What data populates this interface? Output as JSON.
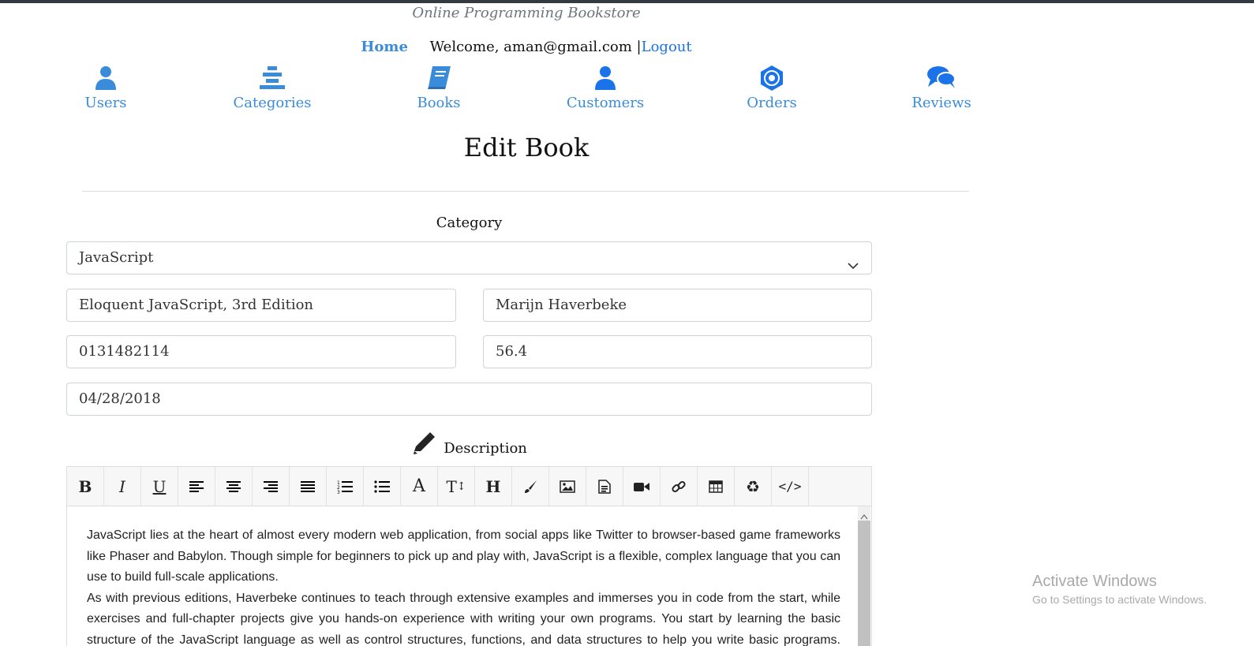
{
  "site": {
    "brand": "Online Programming Bookstore"
  },
  "nav": {
    "home": "Home",
    "welcome": "Welcome, aman@gmail.com |",
    "logout": "Logout"
  },
  "menu": [
    {
      "label": "Users",
      "icon": "user-icon"
    },
    {
      "label": "Categories",
      "icon": "layers-icon"
    },
    {
      "label": "Books",
      "icon": "book-icon"
    },
    {
      "label": "Customers",
      "icon": "customer-icon"
    },
    {
      "label": "Orders",
      "icon": "orders-icon"
    },
    {
      "label": "Reviews",
      "icon": "comments-icon"
    }
  ],
  "page": {
    "title": "Edit Book"
  },
  "form": {
    "category_label": "Category",
    "category_value": "JavaScript",
    "title_value": "Eloquent JavaScript, 3rd Edition",
    "author_value": " Marijn Haverbeke",
    "isbn_value": "0131482114",
    "price_value": "56.4",
    "publish_date_value": "04/28/2018",
    "description_label": "Description",
    "description_p1": "JavaScript lies at the heart of almost every modern web application, from social apps like Twitter to browser-based game frameworks like Phaser and Babylon. Though simple for beginners to pick up and play with, JavaScript is a flexible, complex language that you can use to build full-scale applications.",
    "description_p2": "As with previous editions, Haverbeke continues to teach through extensive examples and immerses you in code from the start, while exercises and full-chapter projects give you hands-on experience with writing your own programs. You start by learning the basic structure of the JavaScript language as well as control structures, functions, and data structures to help you write basic programs. Then you'll learn"
  },
  "toolbar": [
    "bold-icon",
    "italic-icon",
    "underline-icon",
    "align-left-icon",
    "align-center-icon",
    "align-right-icon",
    "align-justify-icon",
    "ordered-list-icon",
    "unordered-list-icon",
    "font-color-icon",
    "font-size-icon",
    "heading-icon",
    "brush-icon",
    "image-icon",
    "file-icon",
    "video-icon",
    "link-icon",
    "table-icon",
    "recycle-icon",
    "code-view-icon"
  ],
  "watermark": {
    "line1": "Activate Windows",
    "line2": "Go to Settings to activate Windows."
  },
  "colors": {
    "accent": "#3a8bd9",
    "link": "#1a73e8",
    "topbar": "#343a40"
  }
}
